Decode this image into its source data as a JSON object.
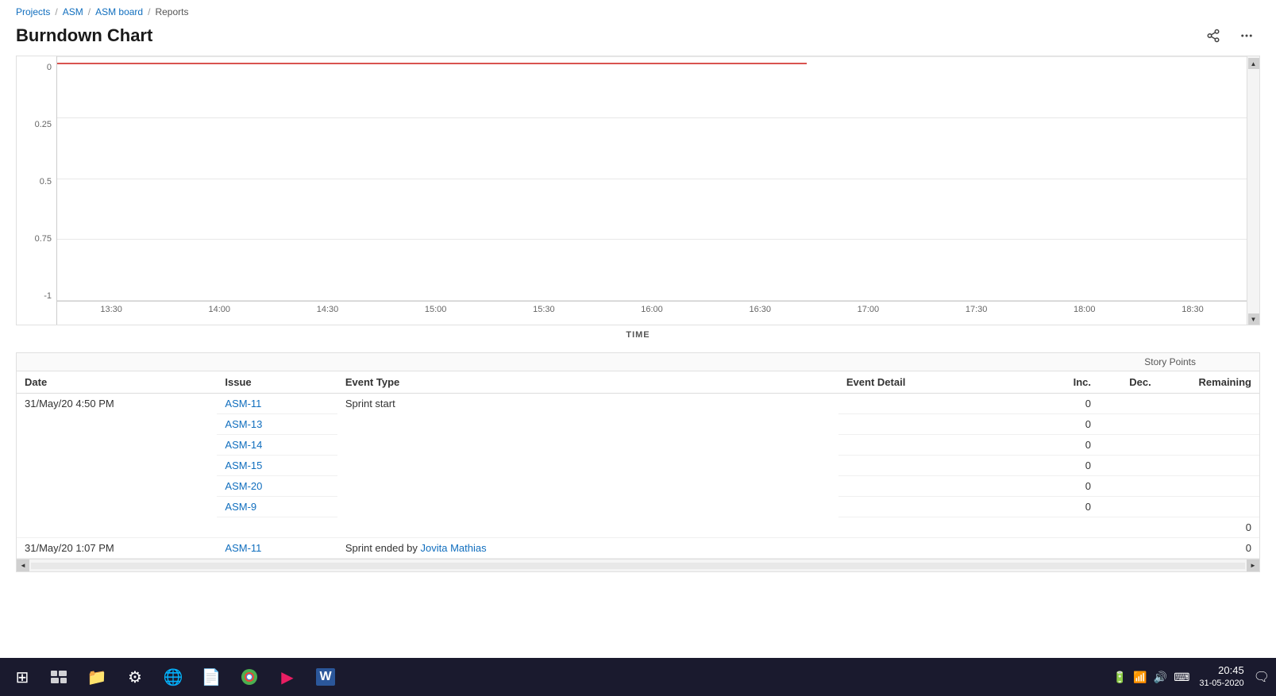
{
  "breadcrumb": {
    "items": [
      {
        "label": "Projects",
        "link": true
      },
      {
        "label": "ASM",
        "link": true
      },
      {
        "label": "ASM board",
        "link": true
      },
      {
        "label": "Reports",
        "link": false
      }
    ],
    "separators": [
      "/",
      "/",
      "/"
    ]
  },
  "page": {
    "title": "Burndown Chart"
  },
  "header_actions": {
    "share_label": "⛁",
    "more_label": "⋯"
  },
  "chart": {
    "x_axis_label": "TIME",
    "y_labels": [
      "0",
      "0.25",
      "0.5",
      "0.75",
      "-1"
    ],
    "x_labels": [
      "13:30",
      "14:00",
      "14:30",
      "15:00",
      "15:30",
      "16:00",
      "16:30",
      "17:00",
      "17:30",
      "18:00",
      "18:30"
    ]
  },
  "table": {
    "story_points_header": "Story Points",
    "columns": [
      "Date",
      "Issue",
      "Event Type",
      "Event Detail",
      "Inc.",
      "Dec.",
      "Remaining"
    ],
    "rows": [
      {
        "date": "31/May/20 4:50 PM",
        "issues": [
          "ASM-11",
          "ASM-13",
          "ASM-14",
          "ASM-15",
          "ASM-20",
          "ASM-9"
        ],
        "event_type": "Sprint start",
        "event_detail": "",
        "inc": [
          "0",
          "0",
          "0",
          "0",
          "0",
          "0"
        ],
        "dec": [],
        "remaining": ""
      },
      {
        "date": "",
        "issues": [],
        "event_type": "",
        "event_detail": "",
        "inc": [],
        "dec": [],
        "remaining": "0"
      },
      {
        "date": "31/May/20 1:07 PM",
        "issues": [
          "ASM-11"
        ],
        "event_type": "Sprint ended by Jovita Mathias",
        "event_detail": "",
        "inc": [],
        "dec": [],
        "remaining": "0"
      }
    ]
  },
  "taskbar": {
    "time": "20:45",
    "date": "31-05-2020",
    "apps": [
      {
        "name": "task-view",
        "icon": "⊞"
      },
      {
        "name": "file-explorer",
        "icon": "📁"
      },
      {
        "name": "settings",
        "icon": "⚙"
      },
      {
        "name": "edge",
        "icon": "🌐"
      },
      {
        "name": "word-reader",
        "icon": "W"
      },
      {
        "name": "chrome",
        "icon": "●"
      },
      {
        "name": "media-player",
        "icon": "▶"
      },
      {
        "name": "word",
        "icon": "W"
      }
    ],
    "sys_icons": [
      "🔋",
      "📶",
      "🔊",
      "⌨"
    ]
  }
}
